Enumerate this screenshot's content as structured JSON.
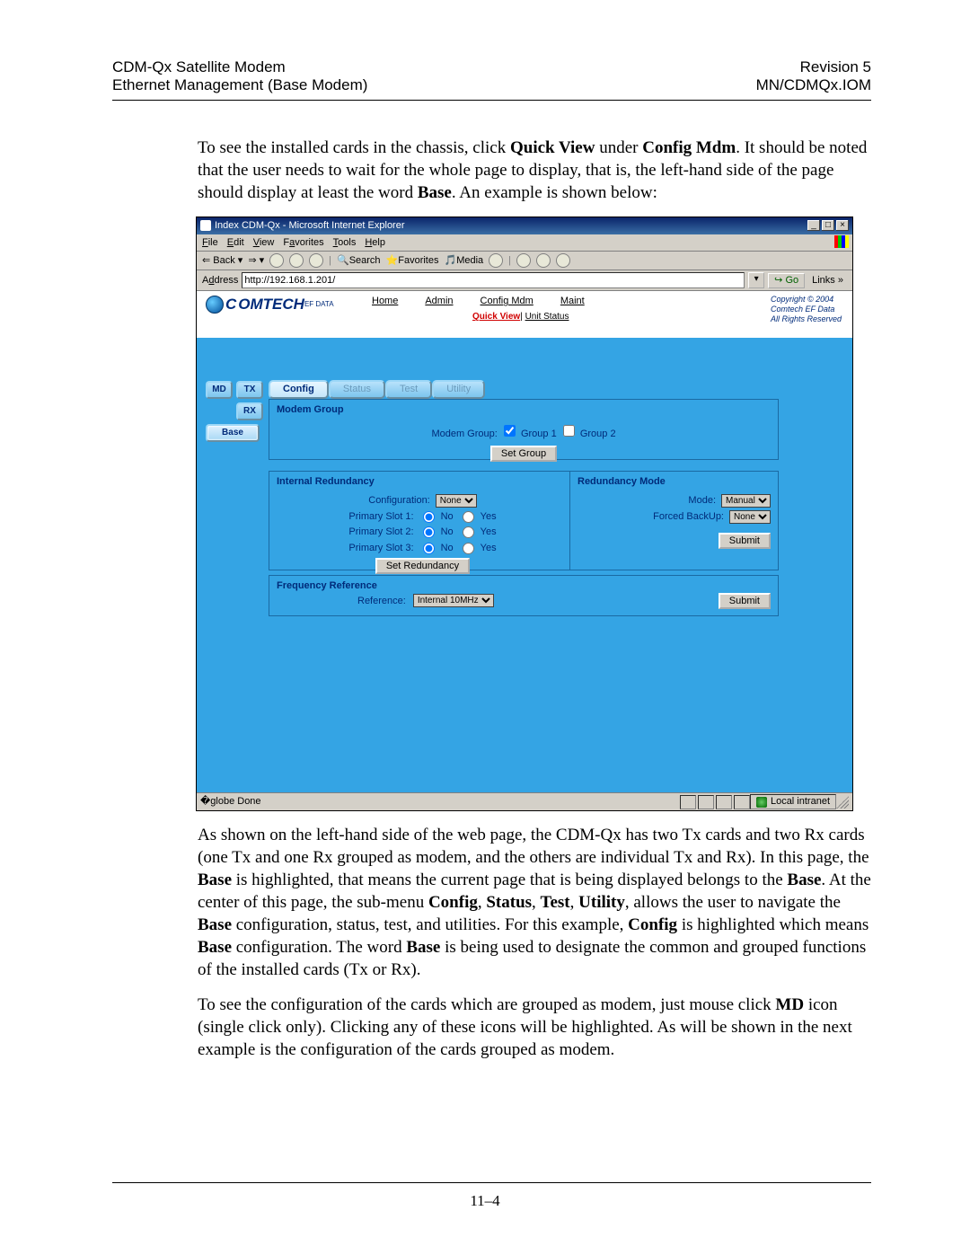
{
  "header": {
    "left1": "CDM-Qx Satellite Modem",
    "left2": "Ethernet Management (Base Modem)",
    "right1": "Revision 5",
    "right2": "MN/CDMQx.IOM"
  },
  "intro": {
    "pre": "To see the installed cards in the chassis, click ",
    "quickview": "Quick View",
    "mid": " under ",
    "configmdm": "Config Mdm",
    "post1": ". It should be noted that the user needs to wait for the whole page to display, that is, the left-hand side of the page should display at least the word ",
    "baseword": "Base",
    "post2": ". An example is shown below:"
  },
  "ie": {
    "title": "Index CDM-Qx - Microsoft Internet Explorer",
    "menus": [
      "File",
      "Edit",
      "View",
      "Favorites",
      "Tools",
      "Help"
    ],
    "toolbar": {
      "back": "Back",
      "search": "Search",
      "favorites": "Favorites",
      "media": "Media"
    },
    "addressLabel": "Address",
    "url": "http://192.168.1.201/",
    "go": "Go",
    "links": "Links",
    "statusDone": "Done",
    "statusZone": "Local intranet"
  },
  "banner": {
    "logoMain": "OMTECH",
    "logoSub": "EF DATA",
    "nav": [
      "Home",
      "Admin",
      "Config Mdm",
      "Maint"
    ],
    "quickView": "Quick View",
    "unitStatus": "Unit Status",
    "copyright1": "Copyright © 2004",
    "copyright2": "Comtech EF Data",
    "copyright3": "All Rights Reserved"
  },
  "slots": {
    "md": "MD",
    "tx": "TX",
    "rx": "RX",
    "base": "Base"
  },
  "subtabs": [
    "Config",
    "Status",
    "Test",
    "Utility"
  ],
  "modemGroup": {
    "title": "Modem Group",
    "label": "Modem Group:",
    "g1": "Group 1",
    "g2": "Group 2",
    "btn": "Set Group"
  },
  "internalRedundancy": {
    "title": "Internal Redundancy",
    "configLabel": "Configuration:",
    "configValue": "None",
    "p1": "Primary Slot 1:",
    "p2": "Primary Slot 2:",
    "p3": "Primary Slot 3:",
    "no": "No",
    "yes": "Yes",
    "btn": "Set Redundancy"
  },
  "redundancyMode": {
    "title": "Redundancy Mode",
    "modeLabel": "Mode:",
    "modeValue": "Manual",
    "fbLabel": "Forced BackUp:",
    "fbValue": "None",
    "btn": "Submit"
  },
  "freqRef": {
    "title": "Frequency Reference",
    "label": "Reference:",
    "value": "Internal 10MHz",
    "btn": "Submit"
  },
  "para2": "As shown on the left-hand side of the web page, the CDM-Qx has two Tx cards and two Rx cards (one Tx and one Rx grouped as modem, and the others are individual Tx and Rx). In this page, the <b>Base</b> is highlighted, that means the current page that is being displayed belongs to the <b>Base</b>. At the center of this page, the sub-menu <b>Config</b>, <b>Status</b>, <b>Test</b>, <b>Utility</b>, allows the user to navigate the <b>Base</b> configuration, status, test, and utilities. For this example, <b>Config</b> is highlighted which means <b>Base</b> configuration. The word <b>Base</b> is being used to designate the common and grouped functions of the installed cards (Tx or Rx).",
  "para3": "To see the configuration of the cards which are grouped as modem, just mouse click <b>MD</b> icon (single click only). Clicking any of these icons will be highlighted. As will be shown in the next example is the configuration of the cards grouped as modem.",
  "pageNum": "11–4"
}
